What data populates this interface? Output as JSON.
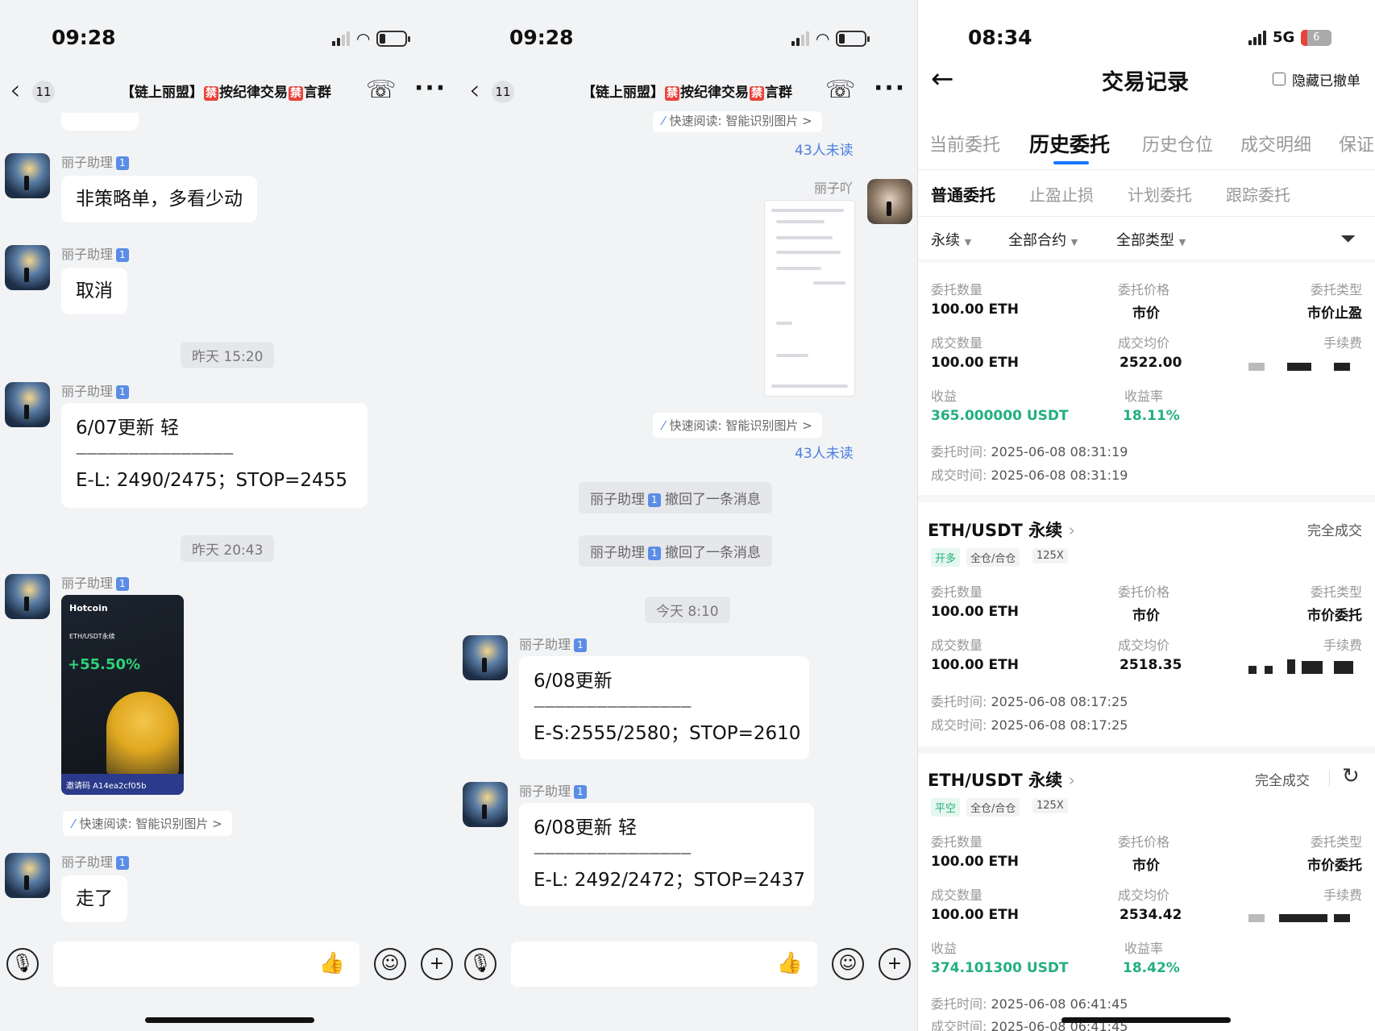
{
  "chat1": {
    "time": "09:28",
    "back_count": "11",
    "title_prefix": "【链上丽盟】",
    "title_ban": "禁",
    "title_mid": "按纪律交易",
    "title_suffix": "言群",
    "messages": [
      {
        "sender": "丽子助理",
        "level": "1",
        "text": "非策略单，多看少动"
      },
      {
        "sender": "丽子助理",
        "level": "1",
        "text": "取消"
      },
      {
        "sender": "丽子助理",
        "level": "1",
        "line1": "6/07更新  轻",
        "line2": "———————————————",
        "line3": "E-L: 2490/2475；STOP=2455"
      },
      {
        "sender": "丽子助理",
        "level": "1"
      },
      {
        "sender": "丽子助理",
        "level": "1",
        "text": "走了"
      }
    ],
    "timestamps": [
      "昨天 15:20",
      "昨天 20:43"
    ],
    "image_card": {
      "brand": "Hotcoin",
      "pair": "ETH/USDT永续",
      "pct": "+55.50%",
      "code": "邀请码 A14ea2cf05b"
    },
    "ai_read": "快速阅读: 智能识别图片 >"
  },
  "chat2": {
    "time": "09:28",
    "back_count": "11",
    "ai_read_top": "快速阅读: 智能识别图片 >",
    "unread_top": "43人未读",
    "other_sender": "丽子吖",
    "ai_read": "快速阅读: 智能识别图片 >",
    "unread": "43人未读",
    "recall_sender": "丽子助理",
    "recall_level": "1",
    "recall_text": "撤回了一条消息",
    "timestamp": "今天 8:10",
    "messages": [
      {
        "sender": "丽子助理",
        "level": "1",
        "line1": "6/08更新",
        "line2": "———————————————",
        "line3": "E-S:2555/2580；STOP=2610"
      },
      {
        "sender": "丽子助理",
        "level": "1",
        "line1": "6/08更新  轻",
        "line2": "———————————————",
        "line3": "E-L: 2492/2472；STOP=2437"
      }
    ]
  },
  "trade": {
    "time": "08:34",
    "network": "5G",
    "battery": "6",
    "title": "交易记录",
    "hide_cancelled": "隐藏已撤单",
    "tabs": [
      "当前委托",
      "历史委托",
      "历史仓位",
      "成交明细",
      "保证"
    ],
    "subtabs": [
      "普通委托",
      "止盈止损",
      "计划委托",
      "跟踪委托"
    ],
    "filters": [
      "永续",
      "全部合约",
      "全部类型"
    ],
    "labels": {
      "qty": "委托数量",
      "price": "委托价格",
      "type": "委托类型",
      "fill_qty": "成交数量",
      "avg": "成交均价",
      "fee": "手续费",
      "pnl": "收益",
      "roi": "收益率",
      "order_time": "委托时间:",
      "fill_time": "成交时间:"
    },
    "records": [
      {
        "qty": "100.00 ETH",
        "price": "市价",
        "type": "市价止盈",
        "fill_qty": "100.00 ETH",
        "avg": "2522.00",
        "pnl": "365.000000 USDT",
        "roi": "18.11%",
        "order_time": "2025-06-08 08:31:19",
        "fill_time": "2025-06-08 08:31:19"
      },
      {
        "pair": "ETH/USDT 永续",
        "status": "完全成交",
        "tags": [
          "开多",
          "全仓/合仓",
          "125X"
        ],
        "qty": "100.00 ETH",
        "price": "市价",
        "type": "市价委托",
        "fill_qty": "100.00 ETH",
        "avg": "2518.35",
        "order_time": "2025-06-08 08:17:25",
        "fill_time": "2025-06-08 08:17:25"
      },
      {
        "pair": "ETH/USDT 永续",
        "status": "完全成交",
        "tags": [
          "平空",
          "全仓/合仓",
          "125X"
        ],
        "qty": "100.00 ETH",
        "price": "市价",
        "type": "市价委托",
        "fill_qty": "100.00 ETH",
        "avg": "2534.42",
        "pnl": "374.101300 USDT",
        "roi": "18.42%",
        "order_time": "2025-06-08 06:41:45",
        "fill_time": "2025-06-08 06:41:45"
      }
    ]
  }
}
